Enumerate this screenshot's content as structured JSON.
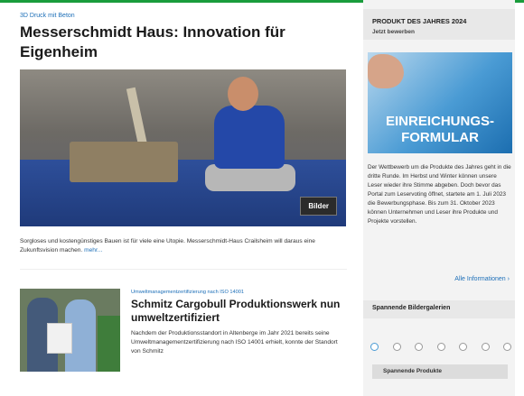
{
  "hero": {
    "kicker": "3D Druck mit Beton",
    "title": "Messerschmidt Haus: Innovation für Eigenheim",
    "image_button": "Bilder",
    "teaser": "Sorgloses und kostengünstiges Bauen ist für viele eine Utopie. Messerschmidt-Haus Crailsheim will daraus eine Zukunftsvision machen.",
    "more_link": "mehr..."
  },
  "article2": {
    "kicker": "Umweltmanagementzertifizierung nach ISO 14001",
    "title": "Schmitz Cargobull Produktionswerk nun umweltzertifiziert",
    "text": "Nachdem der Produktionsstandort in Altenberge im Jahr 2021 bereits seine Umweltmanagementzertifizierung nach ISO 14001 erhielt, konnte der Standort von Schmitz"
  },
  "sidebar": {
    "title": "PRODUKT DES JAHRES 2024",
    "subtitle": "Jetzt bewerben",
    "promo_line1": "EINREICHUNGS-",
    "promo_line2": "FORMULAR",
    "text": "Der Wettbewerb um die Produkte des Jahres geht in die dritte Runde. Im Herbst und Winter können unsere Leser wieder ihre Stimme abgeben. Doch bevor das Portal zum Leservoting öffnet, startete am 1. Juli 2023 die Bewerbungsphase. Bis zum 31. Oktober 2023 können Unternehmen und Leser ihre Produkte und Projekte vorstellen.",
    "more_link": "Alle Informationen",
    "gallery_title": "Spannende Bildergalerien",
    "bottom_label": "Spannende Produkte"
  },
  "colors": {
    "accent": "#1d6fb8",
    "topline": "#1a9c3c"
  }
}
